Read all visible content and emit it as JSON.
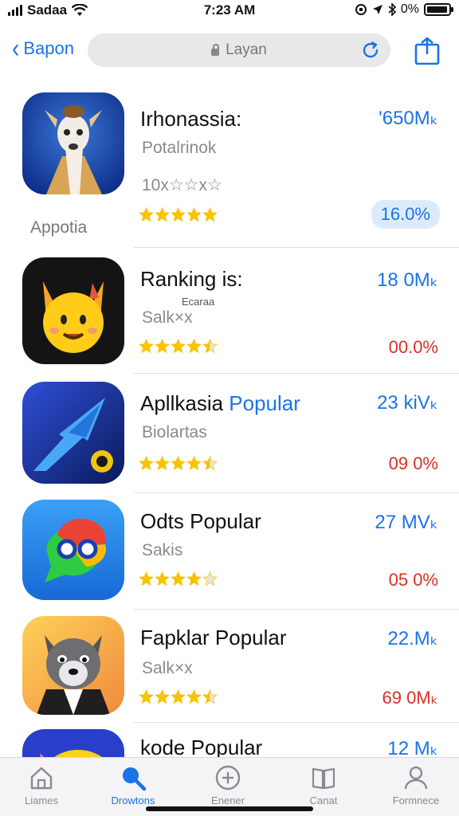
{
  "status_bar": {
    "carrier": "Sadaa",
    "time": "7:23 AM",
    "battery_text": "0%",
    "battery_level": 0.95
  },
  "nav": {
    "back_label": "Bapon",
    "address": "Layan"
  },
  "apps": [
    {
      "title": "Irhonassia:",
      "title_accent": "",
      "subtitle": "Potalrinok",
      "subtitle2": "10x☆☆x☆",
      "small_label": "",
      "caption": "Appotia",
      "size": "'650Mₖ",
      "percent": "16.0%",
      "percent_style": "pill",
      "rating": 5,
      "icon": "deer-icon"
    },
    {
      "title": "Ranking is:",
      "title_accent": "",
      "subtitle": "Salk×x",
      "subtitle2": "",
      "small_label": "Ecaraa",
      "caption": "",
      "size": "18 0Mₖ",
      "percent": "00.0%",
      "percent_style": "red",
      "rating": 4.5,
      "icon": "fox-face-icon"
    },
    {
      "title": "Apllkasia",
      "title_accent": "Popular",
      "subtitle": "Biolartas",
      "subtitle2": "",
      "small_label": "",
      "caption": "",
      "size": "23 kiVₖ",
      "percent": "09 0%",
      "percent_style": "red",
      "rating": 4.5,
      "icon": "arrow-icon"
    },
    {
      "title": "Odts Popular",
      "title_accent": "",
      "subtitle": "Sakis",
      "subtitle2": "",
      "small_label": "",
      "caption": "",
      "size": "27 MVₖ",
      "percent": "05 0%",
      "percent_style": "red",
      "rating": 4,
      "icon": "chat-bubble-icon"
    },
    {
      "title": "Fapklar Popular",
      "title_accent": "",
      "subtitle": "Salk×x",
      "subtitle2": "",
      "small_label": "",
      "caption": "",
      "size": "22.Mₖ",
      "percent": "69 0Mₖ",
      "percent_style": "red",
      "rating": 4.5,
      "icon": "wolf-icon"
    },
    {
      "title": "kode Popular",
      "title_accent": "",
      "subtitle": "",
      "subtitle2": "",
      "small_label": "",
      "caption": "",
      "size": "12 Mₖ",
      "percent": "",
      "percent_style": "red",
      "rating": 0,
      "icon": "app-icon"
    }
  ],
  "tabs": [
    {
      "label": "Liames",
      "icon": "home-icon",
      "active": false
    },
    {
      "label": "Drowtons",
      "icon": "search-icon",
      "active": true
    },
    {
      "label": "Enener",
      "icon": "plus-circle-icon",
      "active": false
    },
    {
      "label": "Canat",
      "icon": "book-icon",
      "active": false
    },
    {
      "label": "Formnece",
      "icon": "person-icon",
      "active": false
    }
  ],
  "colors": {
    "accent": "#1a73e8",
    "star": "#f6c400",
    "negative": "#d93025"
  }
}
